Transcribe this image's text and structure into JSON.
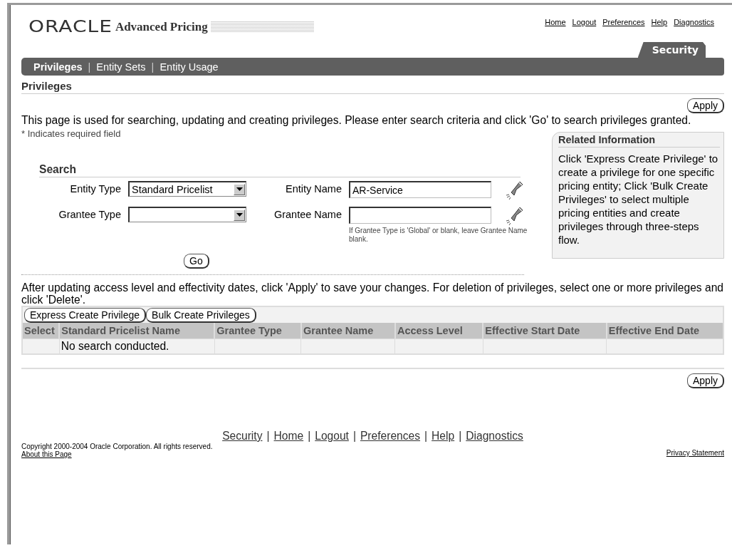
{
  "brand": {
    "logo": "ORACLE",
    "product": "Advanced Pricing"
  },
  "global_links": [
    "Home",
    "Logout",
    "Preferences",
    "Help",
    "Diagnostics"
  ],
  "tabs": [
    {
      "label": "Security",
      "selected": true
    }
  ],
  "subtabs": [
    {
      "label": "Privileges",
      "selected": true
    },
    {
      "label": "Entity Sets",
      "selected": false,
      "separator_before": "|"
    },
    {
      "label": "Entity Usage",
      "selected": false,
      "separator_before": "|"
    }
  ],
  "page_title": "Privileges",
  "top_buttons": [
    "Apply"
  ],
  "instructions": "This page is used for searching, updating and creating privileges. Please enter search criteria and click 'Go' to search privileges granted.",
  "required_note": "* Indicates required field",
  "search": {
    "title": "Search",
    "fields": [
      {
        "label": "Entity Type",
        "kind": "select",
        "value": "Standard Pricelist"
      },
      {
        "label": "Entity Name",
        "kind": "lov",
        "value": "AR-Service"
      },
      {
        "label": "Grantee Type",
        "kind": "select"
      },
      {
        "label": "Grantee Name",
        "kind": "lov",
        "hint": "If Grantee Type is 'Global' or blank, leave Grantee Name blank."
      }
    ],
    "button": "Go"
  },
  "related": {
    "title": "Related Information",
    "text": "Click 'Express Create Privilege' to create a privilege for one specific pricing entity; Click 'Bulk Create Privileges' to select multiple pricing entities and create privileges through three-steps flow."
  },
  "results": {
    "instructions": "After updating access level and effectivity dates, click 'Apply' to save your changes. For deletion of privileges, select one or more privileges and click 'Delete'.",
    "buttons": [
      "Express Create Privilege",
      "Bulk Create Privileges"
    ],
    "columns": [
      "Select",
      "Standard Pricelist Name",
      "Grantee Type",
      "Grantee Name",
      "Access Level",
      "Effective Start Date",
      "Effective End Date"
    ],
    "empty_message": "No search conducted."
  },
  "bottom_buttons": [
    "Apply"
  ],
  "footer": {
    "links": [
      {
        "label": "Security"
      },
      {
        "label": "Home",
        "separator_before": "|"
      },
      {
        "label": "Logout",
        "separator_before": "|"
      },
      {
        "label": "Preferences",
        "separator_before": "|"
      },
      {
        "label": "Help",
        "separator_before": "|"
      },
      {
        "label": "Diagnostics",
        "separator_before": "|"
      }
    ],
    "copyright": "Copyright 2000-2004 Oracle Corporation. All rights reserved.",
    "about": "About this Page",
    "privacy": "Privacy Statement"
  }
}
